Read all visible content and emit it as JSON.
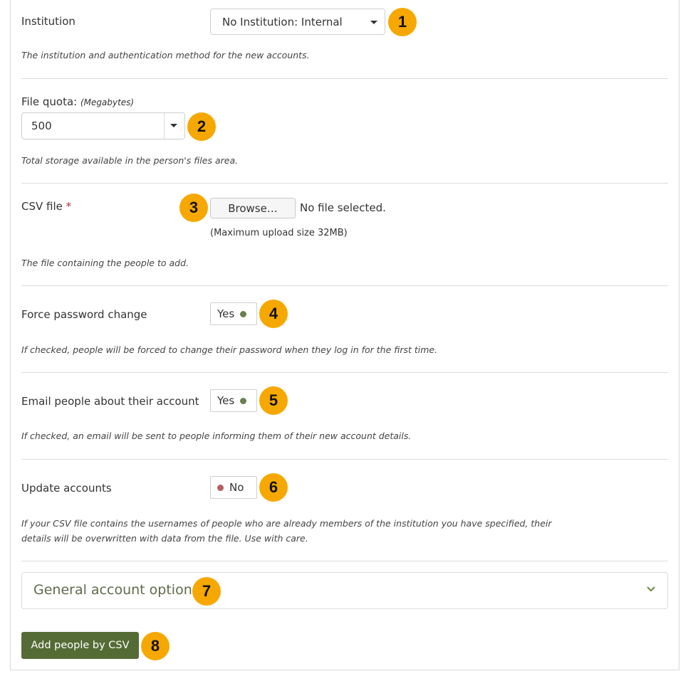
{
  "colors": {
    "badge": "#f6a800",
    "submit": "#556b35",
    "toggle_on_dot": "#6b7f4e",
    "toggle_off_dot": "#b56060",
    "required": "#b03030"
  },
  "institution": {
    "label": "Institution",
    "value": "No Institution: Internal",
    "description": "The institution and authentication method for the new accounts.",
    "badge": "1"
  },
  "quota": {
    "label": "File quota:",
    "unit": "(Megabytes)",
    "value": "500",
    "description": "Total storage available in the person's files area.",
    "badge": "2"
  },
  "csv": {
    "label": "CSV file",
    "required_mark": "*",
    "browse_label": "Browse…",
    "file_status": "No file selected.",
    "max_size": "(Maximum upload size 32MB)",
    "description": "The file containing the people to add.",
    "badge": "3"
  },
  "force_password": {
    "label": "Force password change",
    "state": "Yes",
    "description": "If checked, people will be forced to change their password when they log in for the first time.",
    "badge": "4"
  },
  "email_people": {
    "label": "Email people about their account",
    "state": "Yes",
    "description": "If checked, an email will be sent to people informing them of their new account details.",
    "badge": "5"
  },
  "update_accounts": {
    "label": "Update accounts",
    "state": "No",
    "description_line1": "If your CSV file contains the usernames of people who are already members of the institution you have specified, their",
    "description_line2": "details will be overwritten with data from the file. Use with care.",
    "badge": "6"
  },
  "general_options": {
    "title": "General account options",
    "icon": "chevron-down-icon",
    "badge": "7"
  },
  "submit": {
    "label": "Add people by CSV",
    "badge": "8"
  }
}
